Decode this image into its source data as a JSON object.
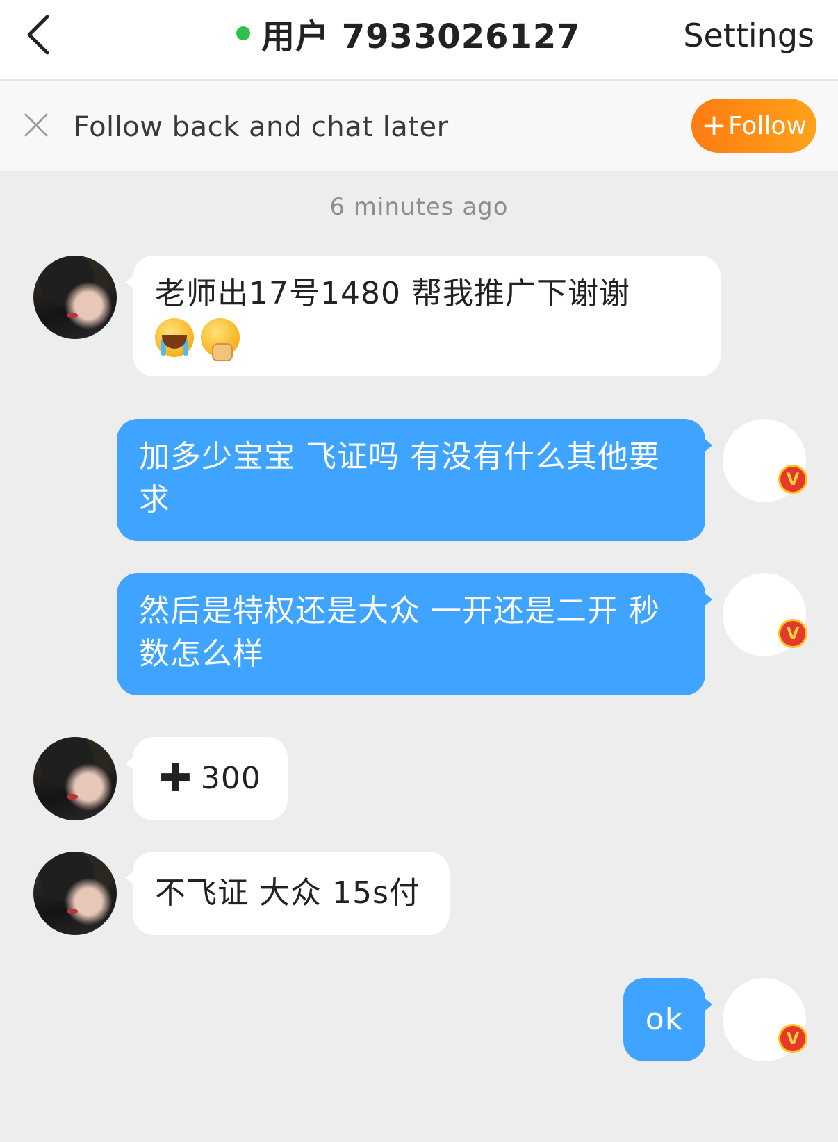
{
  "header": {
    "title": "用户 7933026127",
    "settings_label": "Settings",
    "online_color": "#2ec24a"
  },
  "follow_bar": {
    "text": "Follow back and chat later",
    "button_plus": "+",
    "button_label": "Follow",
    "button_color": "#ff8c16"
  },
  "timestamp": "6 minutes ago",
  "messages": [
    {
      "side": "in",
      "text": "老师出17号1480 帮我推广下谢谢",
      "emojis": [
        "loudly-crying-face",
        "face-with-hand-over-mouth"
      ]
    },
    {
      "side": "out",
      "text": "加多少宝宝 飞证吗 有没有什么其他要求"
    },
    {
      "side": "out",
      "text": "然后是特权还是大众 一开还是二开 秒数怎么样"
    },
    {
      "side": "in",
      "prefix": "✚",
      "text": "300"
    },
    {
      "side": "in",
      "text": "不飞证 大众 15s付"
    },
    {
      "side": "out",
      "text": "ok"
    }
  ],
  "badge_letter": "V",
  "icons": {
    "back": "chevron-left-icon",
    "close": "close-icon",
    "badge": "verified-v-badge-icon"
  }
}
